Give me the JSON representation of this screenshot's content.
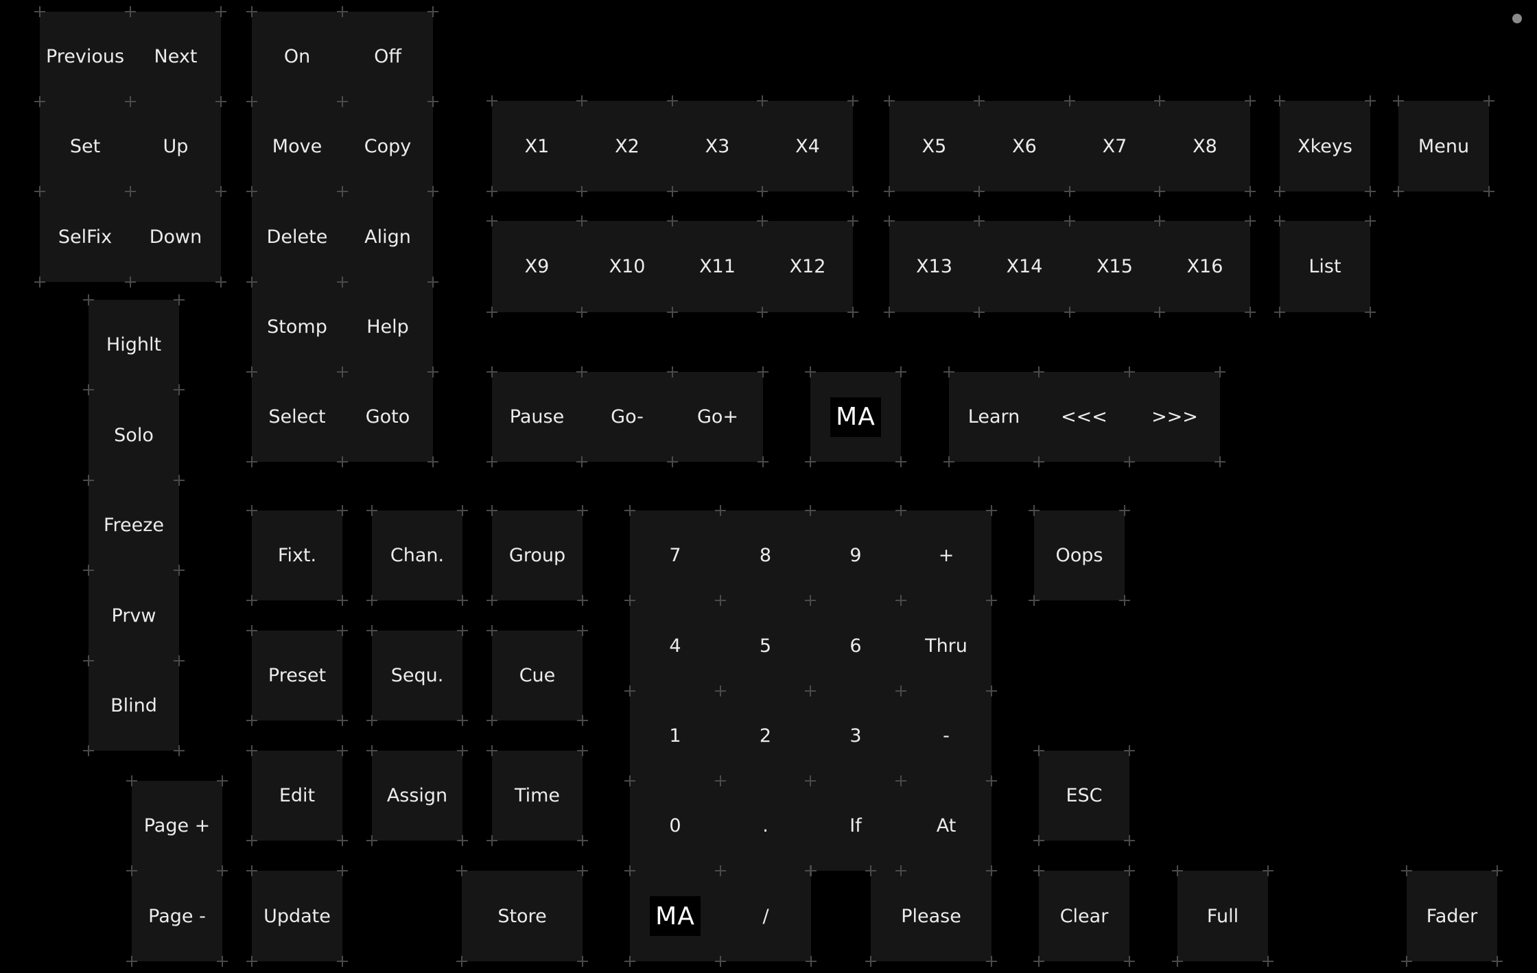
{
  "keypad": {
    "previous": "Previous",
    "next": "Next",
    "set": "Set",
    "up": "Up",
    "selfix": "SelFix",
    "down": "Down",
    "on": "On",
    "off": "Off",
    "move": "Move",
    "copy": "Copy",
    "delete": "Delete",
    "align": "Align",
    "stomp": "Stomp",
    "help": "Help",
    "select": "Select",
    "goto": "Goto",
    "highlt": "Highlt",
    "solo": "Solo",
    "freeze": "Freeze",
    "prvw": "Prvw",
    "blind": "Blind",
    "page_plus": "Page +",
    "page_minus": "Page -",
    "x1": "X1",
    "x2": "X2",
    "x3": "X3",
    "x4": "X4",
    "x5": "X5",
    "x6": "X6",
    "x7": "X7",
    "x8": "X8",
    "x9": "X9",
    "x10": "X10",
    "x11": "X11",
    "x12": "X12",
    "x13": "X13",
    "x14": "X14",
    "x15": "X15",
    "x16": "X16",
    "xkeys": "Xkeys",
    "menu": "Menu",
    "list": "List",
    "pause": "Pause",
    "go_minus": "Go-",
    "go_plus": "Go+",
    "ma": "MA",
    "learn": "Learn",
    "rewind": "<<<",
    "forward": ">>>",
    "fixt": "Fixt.",
    "chan": "Chan.",
    "group": "Group",
    "preset": "Preset",
    "sequ": "Sequ.",
    "cue": "Cue",
    "edit": "Edit",
    "assign": "Assign",
    "time": "Time",
    "update": "Update",
    "store": "Store",
    "n7": "7",
    "n8": "8",
    "n9": "9",
    "plus": "+",
    "n4": "4",
    "n5": "5",
    "n6": "6",
    "thru": "Thru",
    "n1": "1",
    "n2": "2",
    "n3": "3",
    "minus": "-",
    "n0": "0",
    "dot": ".",
    "if": "If",
    "at": "At",
    "slash": "/",
    "please": "Please",
    "oops": "Oops",
    "esc": "ESC",
    "clear": "Clear",
    "full": "Full",
    "fader": "Fader"
  }
}
